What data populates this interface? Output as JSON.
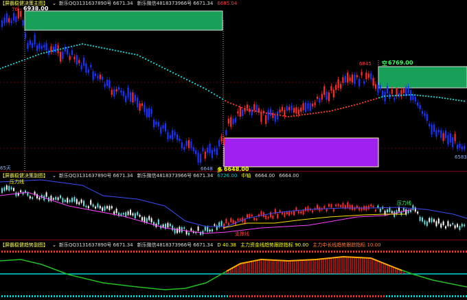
{
  "main_panel": {
    "title": "【屏霸稳健决策主图】",
    "items": [
      "新乐QQ3131637890号 6671.34",
      "新乐微信4818373966号 6671.34"
    ],
    "value_red": "6685.04",
    "level_top": "6938.00",
    "level_top_prefix": "70",
    "level_right": "6769.00",
    "level_right_prefix": "空",
    "level_bottom": "6648.00",
    "level_bottom_prefix": "多",
    "peak_label": "6845",
    "low_label": "6648",
    "right_label": "6583",
    "left_label": "65天"
  },
  "sub_panel": {
    "title": "【屏霸稳健决策副图】",
    "items": [
      "新乐QQ3131637890号 6671.34",
      "新乐微信4818373966号 6671.34"
    ],
    "value_a": "6726.00",
    "mid_label": "中轴",
    "mid_a": "6664.00",
    "mid_b": "6664.00",
    "pressure_left": "压力线",
    "pressure_right": "压力线",
    "support": "支撑线"
  },
  "osc_panel": {
    "title": "【屏霸稳健趋势副图】",
    "items": [
      "新乐QQ3131637890号 6671.34",
      "新乐微信4818373966号 6671.34"
    ],
    "d_value": "D 40.38",
    "signal_a": "主力资金线趋势跟踪指标 90.00",
    "signal_b": "主力中长线趋势跟踪指标 10.00"
  },
  "colors": {
    "up": "#ff2a2a",
    "down": "#1c34ff",
    "green_box": "#18a058",
    "purple_box": "#a020f0",
    "cyan": "#00d8d8",
    "yellow": "#ffe000"
  }
}
